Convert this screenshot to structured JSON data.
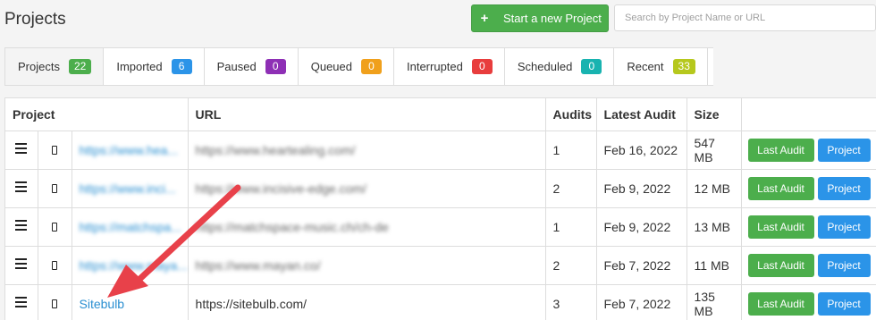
{
  "header": {
    "title": "Projects",
    "new_project_label": "Start a new Project",
    "search_placeholder": "Search by Project Name or URL"
  },
  "tabs": [
    {
      "label": "Projects",
      "count": "22",
      "color": "#4cae4c",
      "active": true
    },
    {
      "label": "Imported",
      "count": "6",
      "color": "#2b94e8"
    },
    {
      "label": "Paused",
      "count": "0",
      "color": "#8e2fb5"
    },
    {
      "label": "Queued",
      "count": "0",
      "color": "#f0a01c"
    },
    {
      "label": "Interrupted",
      "count": "0",
      "color": "#e83d3d"
    },
    {
      "label": "Scheduled",
      "count": "0",
      "color": "#18b3b0"
    },
    {
      "label": "Recent",
      "count": "33",
      "color": "#b6c81d"
    }
  ],
  "table": {
    "columns": [
      "Project",
      "URL",
      "Audits",
      "Latest Audit",
      "Size"
    ],
    "rows": [
      {
        "name": "https://www.hea...",
        "url": "https://www.heartealing.com/",
        "audits": "1",
        "latest": "Feb 16, 2022",
        "size": "547 MB",
        "blurred": true
      },
      {
        "name": "https://www.inci...",
        "url": "https://www.incisive-edge.com/",
        "audits": "2",
        "latest": "Feb 9, 2022",
        "size": "12 MB",
        "blurred": true
      },
      {
        "name": "https://matchspa...",
        "url": "https://matchspace-music.ch/ch-de",
        "audits": "1",
        "latest": "Feb 9, 2022",
        "size": "13 MB",
        "blurred": true
      },
      {
        "name": "https://www.maya...",
        "url": "https://www.mayan.co/",
        "audits": "2",
        "latest": "Feb 7, 2022",
        "size": "11 MB",
        "blurred": true
      },
      {
        "name": "Sitebulb",
        "url": "https://sitebulb.com/",
        "audits": "3",
        "latest": "Feb 7, 2022",
        "size": "135 MB",
        "blurred": false
      }
    ],
    "last_audit_label": "Last Audit",
    "project_label": "Project"
  },
  "colors": {
    "accent_green": "#4cae4c",
    "accent_blue": "#2b94e8",
    "arrow_red": "#e8414a",
    "link": "#2a8fd1"
  }
}
